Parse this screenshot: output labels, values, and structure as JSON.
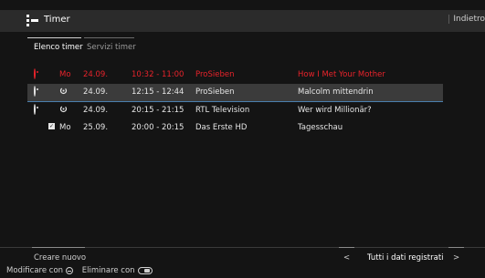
{
  "header": {
    "title": "Timer",
    "back_label": "Indietro"
  },
  "tabs": [
    {
      "label": "Elenco timer",
      "active": true
    },
    {
      "label": "Servizi timer",
      "active": false
    }
  ],
  "timers": [
    {
      "status_icon": "record-dot-icon",
      "day": "Mo",
      "date": "24.09.",
      "time": "10:32 - 11:00",
      "channel": "ProSieben",
      "title": "How I Met Your Mother",
      "color": "#e8232b",
      "selected": false
    },
    {
      "status_icon": "record-dot-icon",
      "recurring_icon": "series-icon",
      "date": "24.09.",
      "time": "12:15 - 12:44",
      "channel": "ProSieben",
      "title": "Malcolm mittendrin",
      "selected": true
    },
    {
      "status_icon": "record-dot-icon",
      "recurring_icon": "series-icon",
      "date": "24.09.",
      "time": "20:15 - 21:15",
      "channel": "RTL Television",
      "title": "Wer wird Millionär?",
      "selected": false
    },
    {
      "status_icon": "reminder-check-icon",
      "day": "Mo",
      "date": "25.09.",
      "time": "20:00 - 20:15",
      "channel": "Das Erste HD",
      "title": "Tagesschau",
      "selected": false
    }
  ],
  "footer": {
    "create_label": "Creare nuovo",
    "nav_prev": "<",
    "nav_label": "Tutti i dati registrati",
    "nav_next": ">",
    "hint_edit": "Modificare con",
    "hint_delete": "Eliminare con"
  },
  "colors": {
    "accent_red": "#e8232b",
    "selection_line": "#4a7fae"
  }
}
